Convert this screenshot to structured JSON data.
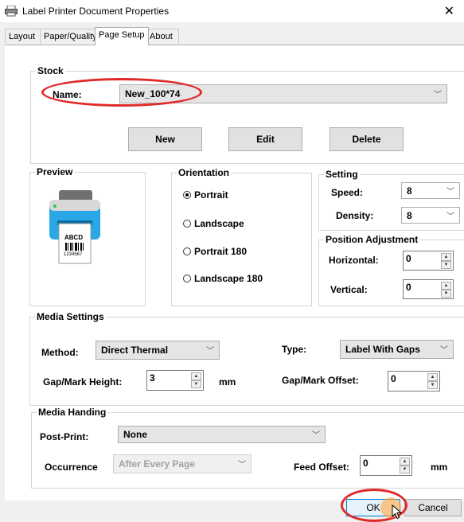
{
  "window": {
    "title": "Label Printer Document Properties",
    "close_glyph": "✕"
  },
  "tabs": [
    {
      "label": "Layout"
    },
    {
      "label": "Paper/Quality"
    },
    {
      "label": "Page Setup"
    },
    {
      "label": "About"
    }
  ],
  "stock": {
    "group_label": "Stock",
    "name_label": "Name:",
    "name_value": "New_100*74",
    "new_label": "New",
    "edit_label": "Edit",
    "delete_label": "Delete"
  },
  "preview": {
    "group_label": "Preview",
    "label_text": "ABCD",
    "label_number": "1234567"
  },
  "orientation": {
    "group_label": "Orientation",
    "options": [
      {
        "label": "Portrait",
        "selected": true
      },
      {
        "label": "Landscape",
        "selected": false
      },
      {
        "label": "Portrait 180",
        "selected": false
      },
      {
        "label": "Landscape 180",
        "selected": false
      }
    ]
  },
  "setting": {
    "group_label": "Setting",
    "speed_label": "Speed:",
    "speed_value": "8",
    "density_label": "Density:",
    "density_value": "8"
  },
  "position": {
    "group_label": "Position Adjustment",
    "horizontal_label": "Horizontal:",
    "horizontal_value": "0",
    "vertical_label": "Vertical:",
    "vertical_value": "0"
  },
  "media_settings": {
    "group_label": "Media Settings",
    "method_label": "Method:",
    "method_value": "Direct Thermal",
    "type_label": "Type:",
    "type_value": "Label With Gaps",
    "gap_height_label": "Gap/Mark Height:",
    "gap_height_value": "3",
    "gap_height_unit": "mm",
    "gap_offset_label": "Gap/Mark Offset:",
    "gap_offset_value": "0"
  },
  "media_handing": {
    "group_label": "Media Handing",
    "post_print_label": "Post-Print:",
    "post_print_value": "None",
    "occurrence_label": "Occurrence",
    "occurrence_value": "After Every Page",
    "feed_offset_label": "Feed Offset:",
    "feed_offset_value": "0",
    "feed_offset_unit": "mm"
  },
  "footer": {
    "ok_label": "OK",
    "cancel_label": "Cancel"
  },
  "colors": {
    "annotation_red": "#e02a2a",
    "printer_blue": "#2aa7e6"
  }
}
